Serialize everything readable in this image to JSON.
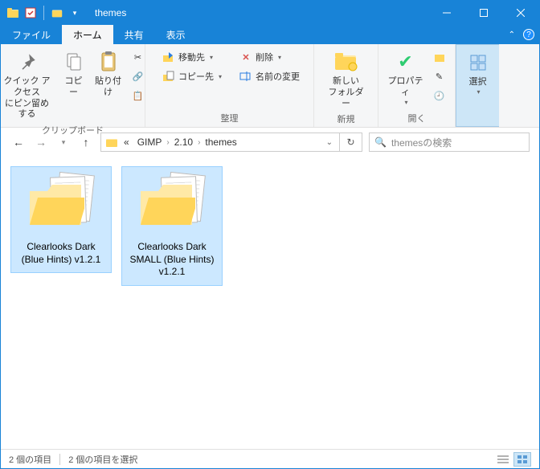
{
  "window": {
    "title": "themes"
  },
  "tabs": {
    "file": "ファイル",
    "home": "ホーム",
    "share": "共有",
    "view": "表示"
  },
  "ribbon": {
    "clipboard": {
      "pin": "クイック アクセス\nにピン留めする",
      "copy": "コピー",
      "paste": "貼り付け",
      "label": "クリップボード"
    },
    "organize": {
      "moveto": "移動先",
      "copyto": "コピー先",
      "delete": "削除",
      "rename": "名前の変更",
      "label": "整理"
    },
    "new": {
      "newfolder": "新しい\nフォルダー",
      "label": "新規"
    },
    "open": {
      "properties": "プロパティ",
      "label": "開く"
    },
    "select": {
      "select": "選択",
      "label": ""
    }
  },
  "breadcrumbs": [
    "GIMP",
    "2.10",
    "themes"
  ],
  "breadcrumb_prefix": "«",
  "search": {
    "placeholder": "themesの検索"
  },
  "items": [
    {
      "name": "Clearlooks Dark (Blue Hints) v1.2.1"
    },
    {
      "name": "Clearlooks Dark SMALL (Blue Hints) v1.2.1"
    }
  ],
  "status": {
    "count": "2 個の項目",
    "selected": "2 個の項目を選択"
  }
}
